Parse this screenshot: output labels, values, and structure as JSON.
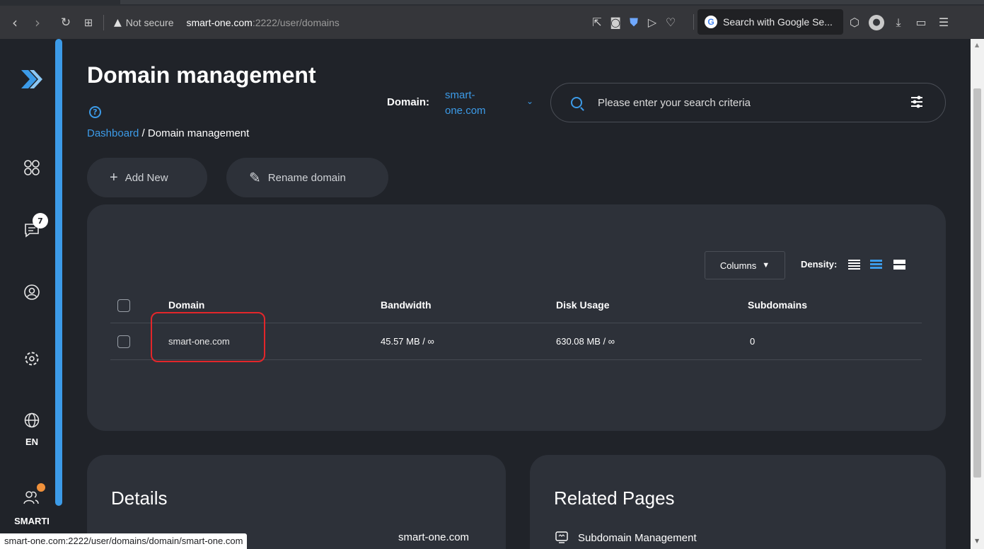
{
  "browser": {
    "security_label": "Not secure",
    "url_host": "smart-one.com",
    "url_rest": ":2222/user/domains",
    "search_placeholder": "Search with Google Se..."
  },
  "sidebar": {
    "badge_count": "7",
    "language": "EN",
    "user_label": "SMARTI"
  },
  "header": {
    "title": "Domain management",
    "breadcrumb_root": "Dashboard",
    "breadcrumb_sep": " / ",
    "breadcrumb_current": "Domain management",
    "domain_label": "Domain:",
    "domain_value": "smart-one.com",
    "search_placeholder": "Please enter your search criteria"
  },
  "toolbar": {
    "add_new": "Add New",
    "rename_domain": "Rename domain"
  },
  "table": {
    "columns_button": "Columns",
    "density_label": "Density:",
    "headers": [
      "Domain",
      "Bandwidth",
      "Disk Usage",
      "Subdomains"
    ],
    "rows": [
      {
        "domain": "smart-one.com",
        "bandwidth": "45.57 MB / ∞",
        "disk_usage": "630.08 MB / ∞",
        "subdomains": "0"
      }
    ]
  },
  "details": {
    "title": "Details",
    "domain_value": "smart-one.com"
  },
  "related": {
    "title": "Related Pages",
    "items": [
      "Subdomain Management"
    ]
  },
  "status_bar": {
    "link": "smart-one.com:2222/user/domains/domain/smart-one.com"
  },
  "colors": {
    "accent": "#3c9be8",
    "background": "#202329",
    "card": "#2d3139",
    "highlight": "#e3262a",
    "notification": "#f0913b"
  }
}
